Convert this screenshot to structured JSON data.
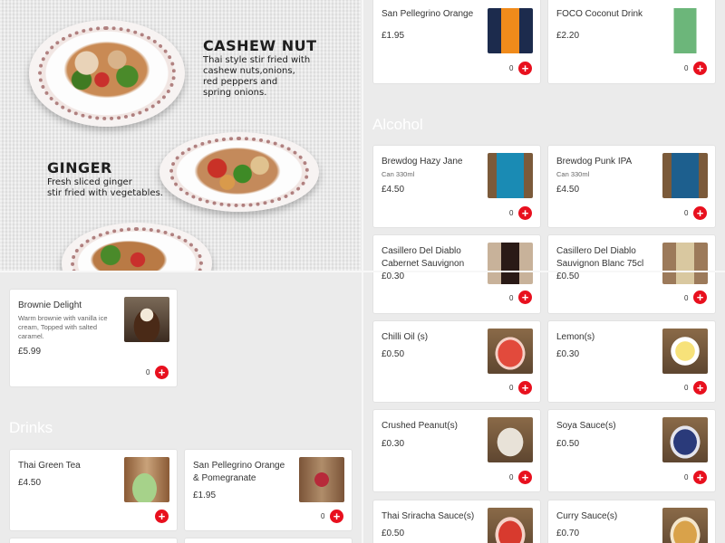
{
  "promo": {
    "dish1_title": "CASHEW NUT",
    "dish1_desc": [
      "Thai style stir fried with",
      "cashew nuts,onions,",
      "red peppers and",
      "spring onions."
    ],
    "dish2_title": "GINGER",
    "dish2_desc": [
      "Fresh sliced ginger",
      "stir fried with vegetables."
    ]
  },
  "sections": {
    "drinks": "Drinks",
    "alcohol": "Alcohol"
  },
  "left_items": [
    {
      "name": "Brownie Delight",
      "desc": [
        "Warm brownie with vanilla ice",
        "cream, Topped with salted",
        "caramel."
      ],
      "price": "£5.99",
      "qty": "0"
    },
    {
      "name": "Thai Green Tea",
      "price": "£4.50"
    },
    {
      "name": [
        "San Pellegrino Orange",
        "& Pomegranate"
      ],
      "price": "£1.95",
      "qty": "0"
    }
  ],
  "right_items": [
    {
      "name": "San Pellegrino Orange",
      "price": "£1.95",
      "qty": "0"
    },
    {
      "name": "FOCO Coconut Drink",
      "price": "£2.20",
      "qty": "0"
    },
    {
      "name": "Brewdog Hazy Jane",
      "sub": "Can 330ml",
      "price": "£4.50",
      "qty": "0"
    },
    {
      "name": "Brewdog Punk IPA",
      "sub": "Can 330ml",
      "price": "£4.50",
      "qty": "0"
    },
    {
      "name": [
        "Casillero Del Diablo",
        "Cabernet Sauvignon"
      ],
      "price": "£0.30",
      "qty": "0"
    },
    {
      "name": [
        "Casillero Del Diablo",
        "Sauvignon Blanc 75cl"
      ],
      "price": "£0.50",
      "qty": "0"
    },
    {
      "name": "Chilli Oil (s)",
      "price": "£0.50",
      "qty": "0"
    },
    {
      "name": "Lemon(s)",
      "price": "£0.30",
      "qty": "0"
    },
    {
      "name": "Crushed Peanut(s)",
      "price": "£0.30",
      "qty": "0"
    },
    {
      "name": "Soya Sauce(s)",
      "price": "£0.50",
      "qty": "0"
    },
    {
      "name": "Thai Sriracha Sauce(s)",
      "price": "£0.50"
    },
    {
      "name": "Curry Sauce(s)",
      "price": "£0.70"
    }
  ],
  "icons": {
    "add": "plus-icon"
  },
  "colors": {
    "accent": "#e8101e",
    "background": "#ebebeb"
  }
}
